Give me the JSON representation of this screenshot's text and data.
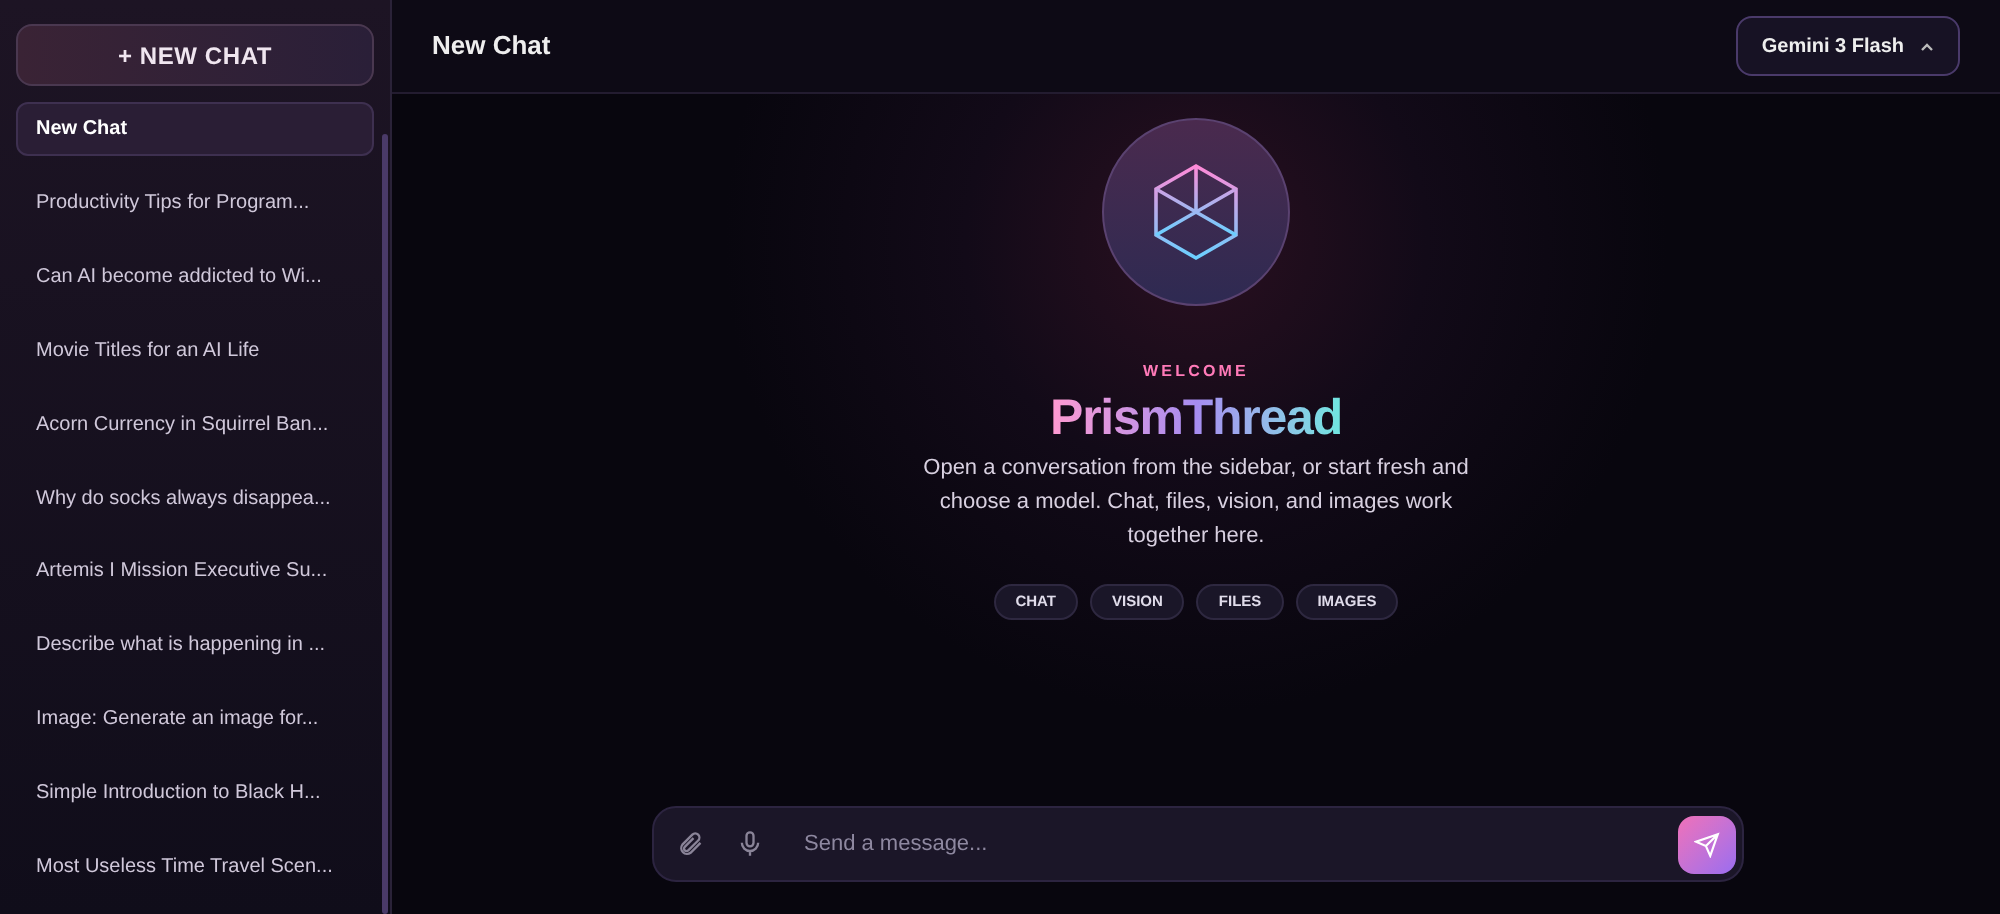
{
  "sidebar": {
    "new_chat_button": "+ NEW CHAT",
    "chats": [
      {
        "title": "New Chat",
        "selected": true
      },
      {
        "title": "Productivity Tips for Program...",
        "selected": false
      },
      {
        "title": "Can AI become addicted to Wi...",
        "selected": false
      },
      {
        "title": "Movie Titles for an AI Life",
        "selected": false
      },
      {
        "title": "Acorn Currency in Squirrel Ban...",
        "selected": false
      },
      {
        "title": "Why do socks always disappea...",
        "selected": false
      },
      {
        "title": "Artemis I Mission Executive Su...",
        "selected": false
      },
      {
        "title": "Describe what is happening in ...",
        "selected": false
      },
      {
        "title": "Image: Generate an image for...",
        "selected": false
      },
      {
        "title": "Simple Introduction to Black H...",
        "selected": false
      },
      {
        "title": "Most Useless Time Travel Scen...",
        "selected": false
      }
    ]
  },
  "header": {
    "title": "New Chat",
    "model_button": "Gemini 3 Flash"
  },
  "welcome": {
    "eyebrow": "WELCOME",
    "brand": "PrismThread",
    "description": "Open a conversation from the sidebar, or start fresh and choose a model. Chat, files, vision, and images work together here.",
    "chips": [
      "CHAT",
      "VISION",
      "FILES",
      "IMAGES"
    ]
  },
  "composer": {
    "placeholder": "Send a message..."
  }
}
